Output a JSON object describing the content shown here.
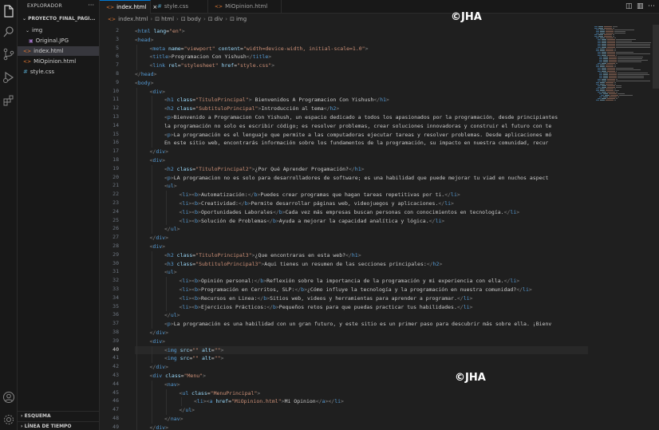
{
  "activity_bar": {
    "icons": [
      "files-icon",
      "search-icon",
      "source-control-icon",
      "run-debug-icon",
      "extensions-icon",
      "account-icon",
      "settings-gear-icon"
    ]
  },
  "sidebar": {
    "title": "EXPLORADOR",
    "more": "···",
    "project": "PROYECTO_FINAL_PAGI...",
    "items": [
      {
        "label": "img",
        "type": "folder"
      },
      {
        "label": "Original.JPG",
        "type": "image"
      },
      {
        "label": "index.html",
        "type": "html"
      },
      {
        "label": "MiOpinion.html",
        "type": "html"
      },
      {
        "label": "style.css",
        "type": "css"
      }
    ],
    "outline": "ESQUEMA",
    "timeline": "LÍNEA DE TIEMPO"
  },
  "tabs": [
    {
      "label": "index.html",
      "icon": "<>",
      "active": true
    },
    {
      "label": "style.css",
      "icon": "#",
      "active": false
    },
    {
      "label": "MiOpinion.html",
      "icon": "<>",
      "active": false
    }
  ],
  "breadcrumb": [
    "index.html",
    "html",
    "body",
    "div",
    "img"
  ],
  "editor": {
    "current_line": 40,
    "lines": [
      {
        "n": 2,
        "i": 0,
        "code": "<html lang=\"en\">"
      },
      {
        "n": 3,
        "i": 0,
        "code": "<head>"
      },
      {
        "n": 5,
        "i": 1,
        "code": "<meta name=\"viewport\" content=\"width=device-width, initial-scale=1.0\">"
      },
      {
        "n": 6,
        "i": 1,
        "code": "<title>Programacion Con Yishush</title>"
      },
      {
        "n": 7,
        "i": 1,
        "code": "<link rel=\"stylesheet\" href=\"style.css\">"
      },
      {
        "n": 8,
        "i": 0,
        "code": "</head>"
      },
      {
        "n": 9,
        "i": 0,
        "code": "<body>"
      },
      {
        "n": 10,
        "i": 1,
        "code": "<div>"
      },
      {
        "n": 11,
        "i": 2,
        "code": "<h1 class=\"TituloPrincipal\"> Bienvenidos A Programacion Con Yishush</h1>"
      },
      {
        "n": 12,
        "i": 2,
        "code": "<h2 class=\"SubtituloPrincipal\">Introducción al tema</h2>"
      },
      {
        "n": 13,
        "i": 2,
        "code": "<p>Bienvenido a Programacion Con Yishush, un espacio dedicado a todos los apasionados por la programación, desde principiantes"
      },
      {
        "n": 14,
        "i": 2,
        "code": "la programación no solo es escribir código; es resolver problemas, crear soluciones innovadoras y construir el futuro con te"
      },
      {
        "n": 15,
        "i": 2,
        "code": "<p>La programación es el lenguaje que permite a las computadoras ejecutar tareas y resolver problemas. Desde aplicaciones mó"
      },
      {
        "n": 16,
        "i": 2,
        "code": "En este sitio web, encontrarás información sobre los fundamentos de la programación, su impacto en nuestra comunidad, recur"
      },
      {
        "n": 17,
        "i": 1,
        "code": "</div>"
      },
      {
        "n": 18,
        "i": 1,
        "code": "<div>"
      },
      {
        "n": 19,
        "i": 2,
        "code": "<h2 class=\"TituloPrincipal2\">¿Por Qué Aprender Progamación?</h1>"
      },
      {
        "n": 20,
        "i": 2,
        "code": "<p>LA programacion no es solo para desarrolladores de software; es una habilidad que puede mejorar tu viad en nuchos aspect"
      },
      {
        "n": 21,
        "i": 2,
        "code": "<ul>"
      },
      {
        "n": 22,
        "i": 3,
        "code": "<li><b>Automatización:</b>Puedes crear programas que hagan tareas repetitivas por ti.</li>"
      },
      {
        "n": 23,
        "i": 3,
        "code": "<li><b>Creatividad:</b>Permite desarrollar páginas web, videojuegos y aplicaciones.</li>"
      },
      {
        "n": 24,
        "i": 3,
        "code": "<li><b>Oportunidades Laborales</b>Cada vez más empresas buscan personas con conocimientos en tecnología.</li>"
      },
      {
        "n": 25,
        "i": 3,
        "code": "<li><b>Solución de Problemas</b>Ayuda a mejorar la capacidad analítica y lógica.</li>"
      },
      {
        "n": 26,
        "i": 2,
        "code": "</ul>"
      },
      {
        "n": 27,
        "i": 1,
        "code": "</div>"
      },
      {
        "n": 28,
        "i": 1,
        "code": "<div>"
      },
      {
        "n": 29,
        "i": 2,
        "code": "<h2 class=\"TituloPrincipal3\">¿Que encontraras en esta web?</h1>"
      },
      {
        "n": 30,
        "i": 2,
        "code": "<h3 class=\"SubtituloPrincipal3\">Aqui tienes un resumen de las secciones principales:</h2>"
      },
      {
        "n": 31,
        "i": 2,
        "code": "<ul>"
      },
      {
        "n": 32,
        "i": 3,
        "code": "<li><b>Opinión personal:</b>Reflexión sobre la importancia de la programación y mi experiencia con ella.</li>"
      },
      {
        "n": 33,
        "i": 3,
        "code": "<li><b>Programación en Cerritos, SLP:</b>¿Cómo influye la tecnología y la programación en nuestra comunidad?</li>"
      },
      {
        "n": 34,
        "i": 3,
        "code": "<li><b>Recursos en Linea:</b>Sitios web, videos y herramientas para aprender a programar.</li>"
      },
      {
        "n": 35,
        "i": 3,
        "code": "<li><b>Ejercicios Prácticos:</b>Pequeños retos para que puedas practicar tus habilidades.</li>"
      },
      {
        "n": 36,
        "i": 2,
        "code": "</ul>"
      },
      {
        "n": 37,
        "i": 2,
        "code": "<p>La programación es una habilidad con un gran futuro, y este sitio es un primer paso para descubrir más sobre ella. ¡Bienv"
      },
      {
        "n": 38,
        "i": 1,
        "code": "</div>"
      },
      {
        "n": 39,
        "i": 1,
        "code": "<div>"
      },
      {
        "n": 40,
        "i": 2,
        "code": "<img src=\"\" alt=\"\">"
      },
      {
        "n": 41,
        "i": 2,
        "code": "<img src=\"\" alt=\"\">"
      },
      {
        "n": 42,
        "i": 1,
        "code": "</div>"
      },
      {
        "n": 43,
        "i": 1,
        "code": "<div class=\"Menu\">"
      },
      {
        "n": 44,
        "i": 2,
        "code": "<nav>"
      },
      {
        "n": 45,
        "i": 3,
        "code": "<ul class=\"MenuPrincipal\">"
      },
      {
        "n": 46,
        "i": 4,
        "code": "<li><a href=\"MiOpinion.html\">Mi Opinion</a></li>"
      },
      {
        "n": 47,
        "i": 3,
        "code": "</ul>"
      },
      {
        "n": 48,
        "i": 2,
        "code": "</nav>"
      },
      {
        "n": 49,
        "i": 1,
        "code": "</div>"
      }
    ]
  },
  "watermarks": [
    "©JHA",
    "©JHA"
  ],
  "colors": {
    "tag": "#569cd6",
    "attribute": "#9cdcfe",
    "string": "#ce9178",
    "bracket": "#808080",
    "text": "#cccccc",
    "accent": "#0078d4"
  }
}
